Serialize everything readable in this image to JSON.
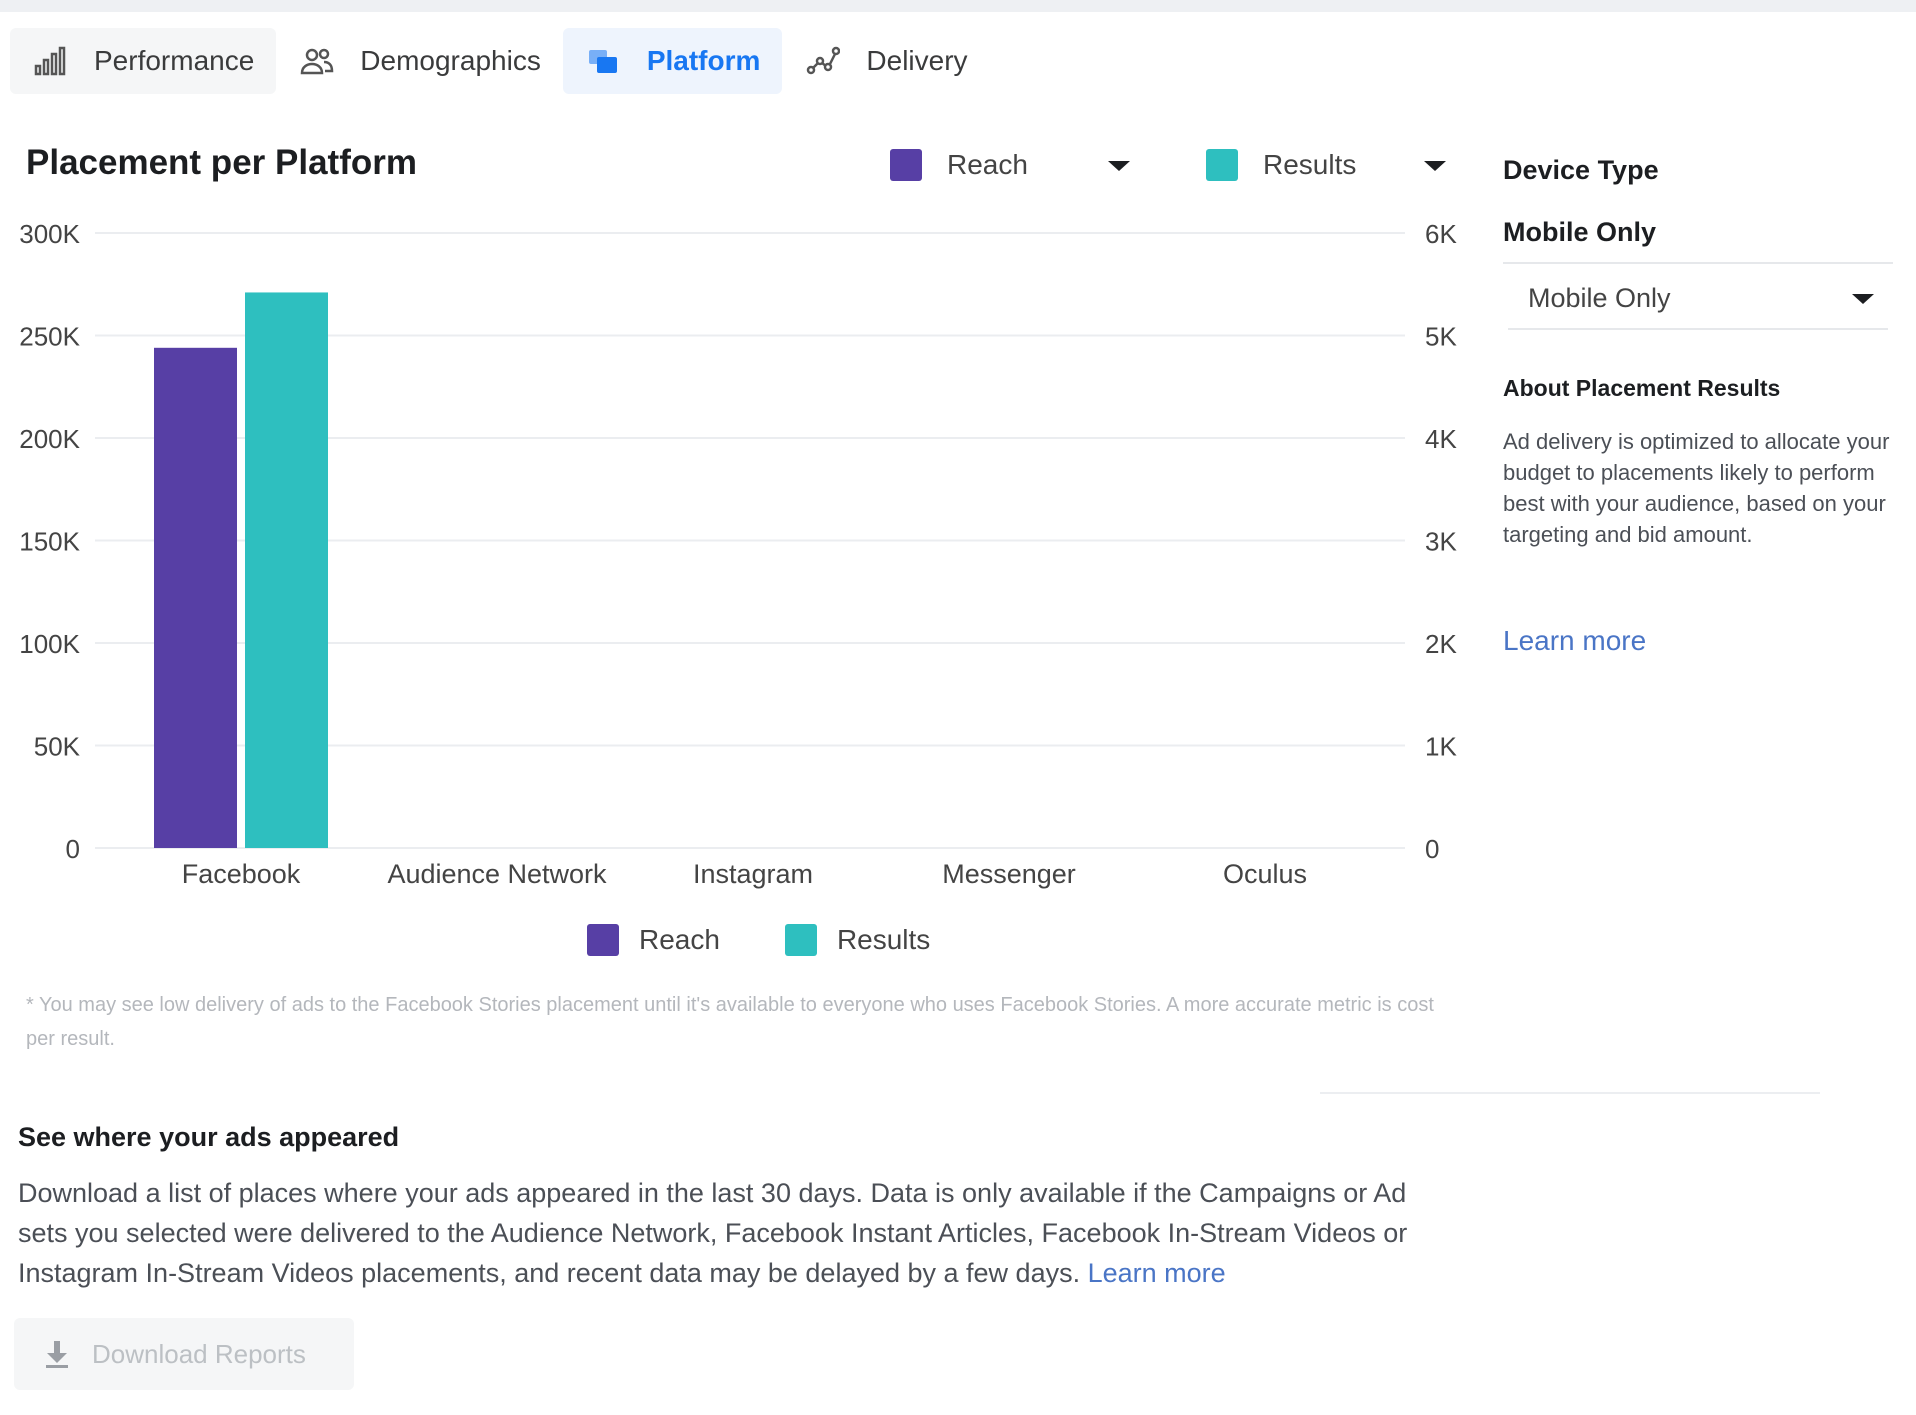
{
  "tabs": [
    {
      "label": "Performance",
      "icon": "bar-chart-icon",
      "active": false
    },
    {
      "label": "Demographics",
      "icon": "people-icon",
      "active": false
    },
    {
      "label": "Platform",
      "icon": "platform-icon",
      "active": true
    },
    {
      "label": "Delivery",
      "icon": "delivery-icon",
      "active": false
    }
  ],
  "chart_header": {
    "title": "Placement per Platform",
    "metric_left": "Reach",
    "metric_right": "Results"
  },
  "colors": {
    "reach": "#573fa5",
    "results": "#2ebfbf",
    "link": "#4a75c6",
    "active_tab": "#1877f2"
  },
  "chart_data": {
    "type": "bar",
    "categories": [
      "Facebook",
      "Audience Network",
      "Instagram",
      "Messenger",
      "Oculus"
    ],
    "series": [
      {
        "name": "Reach",
        "axis": "left",
        "values": [
          244000,
          0,
          0,
          0,
          0
        ]
      },
      {
        "name": "Results",
        "axis": "right",
        "values": [
          5420,
          0,
          0,
          0,
          0
        ]
      }
    ],
    "ylim_left": [
      0,
      300000
    ],
    "ylim_right": [
      0,
      6000
    ],
    "left_ticks": [
      "0",
      "50K",
      "100K",
      "150K",
      "200K",
      "250K",
      "300K"
    ],
    "right_ticks": [
      "0",
      "1K",
      "2K",
      "3K",
      "4K",
      "5K",
      "6K"
    ],
    "grid": true,
    "legend_position": "bottom"
  },
  "legend": {
    "reach": "Reach",
    "results": "Results"
  },
  "footnote": "* You may see low delivery of ads to the Facebook Stories placement until it's available to everyone who uses Facebook Stories. A more accurate metric is cost per result.",
  "right_panel": {
    "title": "Device Type",
    "value": "Mobile Only",
    "dropdown": "Mobile Only",
    "about_title": "About Placement Results",
    "about_text": "Ad delivery is optimized to allocate your budget to placements likely to perform best with your audience, based on your targeting and bid amount.",
    "learn_more": "Learn more"
  },
  "section": {
    "title": "See where your ads appeared",
    "body": "Download a list of places where your ads appeared in the last 30 days. Data is only available if the Campaigns or Ad sets you selected were delivered to the Audience Network, Facebook Instant Articles, Facebook In-Stream Videos or Instagram In-Stream Videos placements, and recent data may be delayed by a few days.",
    "learn_more": "Learn more",
    "download_label": "Download Reports"
  }
}
